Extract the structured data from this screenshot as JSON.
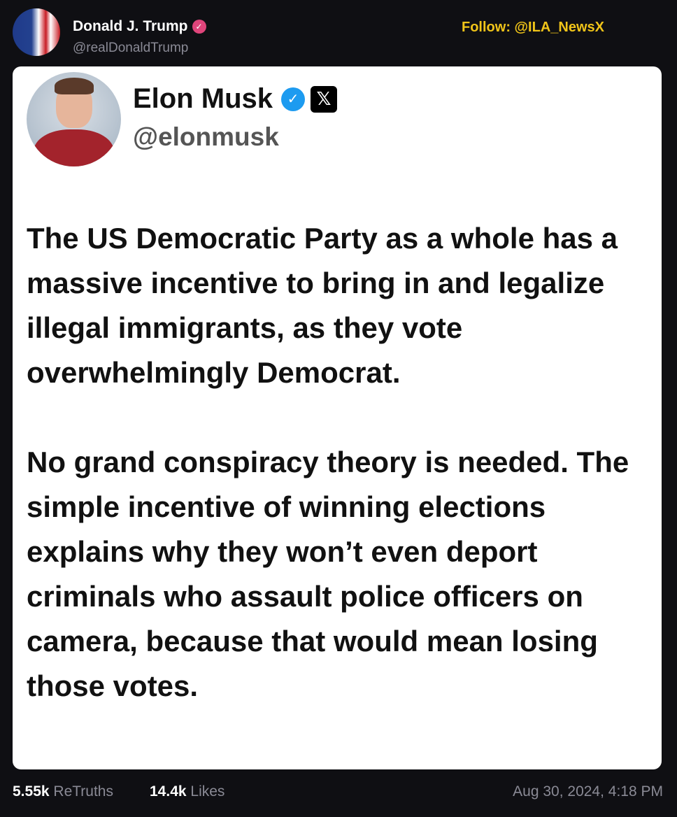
{
  "post": {
    "author_name": "Donald J. Trump",
    "author_handle": "@realDonaldTrump",
    "watermark": "Follow: @ILA_NewsX"
  },
  "quoted": {
    "author_name": "Elon Musk",
    "author_handle": "@elonmusk",
    "paragraphs": [
      "The US Democratic Party as a whole has a massive incentive to bring in and legalize illegal immigrants, as they vote overwhelmingly Democrat.",
      "No grand conspiracy theory is needed. The simple incentive of winning elections explains why they won’t even deport criminals who assault police officers on camera, because that would mean losing those votes."
    ]
  },
  "stats": {
    "retruths_count": "5.55k",
    "retruths_label": "ReTruths",
    "likes_count": "14.4k",
    "likes_label": "Likes",
    "timestamp": "Aug 30, 2024, 4:18 PM"
  },
  "colors": {
    "background": "#0f0f13",
    "watermark": "#f0c419",
    "verified_blue": "#1d9bf0",
    "verified_pink": "#e0457b"
  },
  "icons": {
    "trump_verified": "verified-badge-icon",
    "musk_verified": "verified-check-icon",
    "platform": "x-logo-icon"
  }
}
